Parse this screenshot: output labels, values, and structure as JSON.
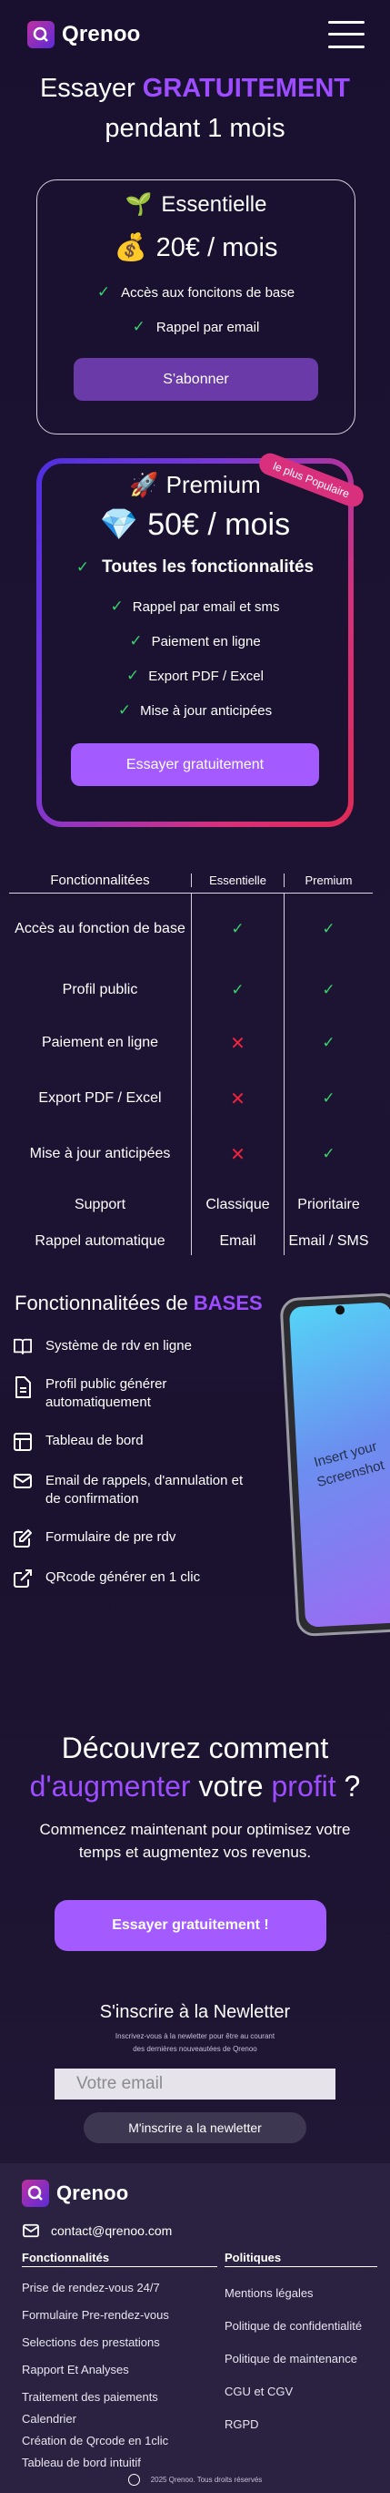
{
  "header": {
    "brand": "Qrenoo",
    "menu_icon": "hamburger-menu-icon"
  },
  "hero": {
    "line1_plain": "Essayer ",
    "line1_accent": "GRATUITEMENT",
    "line2": "pendant 1 mois"
  },
  "plan_basic": {
    "emoji": "🌱",
    "name": "Essentielle",
    "price_emoji": "💰",
    "price": "20€ / mois",
    "features": [
      "Accès aux foncitons de base",
      "Rappel par email"
    ],
    "button": "S'abonner"
  },
  "plan_premium": {
    "ribbon": "le plus Populaire",
    "emoji": "🚀",
    "name": "Premium",
    "price_emoji": "💎",
    "price": "50€ / mois",
    "headline": "Toutes les fonctionnalités",
    "features": [
      "Rappel par email et sms",
      "Paiement en ligne",
      "Export PDF / Excel",
      "Mise à jour anticipées"
    ],
    "button": "Essayer gratuitement"
  },
  "comparison": {
    "headers": [
      "Fonctionnalitées",
      "Essentielle",
      "Premium"
    ],
    "rows": [
      {
        "feature": "Accès au fonction de base",
        "essentielle": "✓",
        "premium": "✓"
      },
      {
        "feature": "Profil public",
        "essentielle": "✓",
        "premium": "✓"
      },
      {
        "feature": "Paiement en ligne",
        "essentielle": "✕",
        "premium": "✓"
      },
      {
        "feature": "Export PDF / Excel",
        "essentielle": "✕",
        "premium": "✓"
      },
      {
        "feature": "Mise à jour anticipées",
        "essentielle": "✕",
        "premium": "✓"
      },
      {
        "feature": "Support",
        "essentielle": "Classique",
        "premium": "Prioritaire"
      },
      {
        "feature": "Rappel automatique",
        "essentielle": "Email",
        "premium": "Email / SMS"
      }
    ]
  },
  "bases": {
    "title_plain": "Fonctionnalitées de ",
    "title_accent": "BASES",
    "items": [
      {
        "icon": "book-icon",
        "label": "Système de rdv en ligne"
      },
      {
        "icon": "document-icon",
        "label": "Profil public générer automatiquement"
      },
      {
        "icon": "dashboard-icon",
        "label": "Tableau de bord"
      },
      {
        "icon": "mail-icon",
        "label": "Email de rappels, d'annulation et de confirmation"
      },
      {
        "icon": "edit-icon",
        "label": "Formulaire de pre rdv"
      },
      {
        "icon": "external-link-icon",
        "label": "QRcode générer en 1 clic"
      }
    ],
    "phone_text": "Insert your Screenshot"
  },
  "discover": {
    "line1": "Découvrez comment",
    "accent1": "d'augmenter",
    "middle": " votre ",
    "accent2": "profit",
    "end": " ?",
    "text": "Commencez maintenant pour optimisez votre temps et augmentez vos revenus.",
    "button": "Essayer gratuitement !"
  },
  "newsletter": {
    "title": "S'inscrire à la Newletter",
    "sub": "Inscrivez-vous à la newletter pour être au courant des dernières nouveautées de Qrenoo",
    "placeholder": "Votre email",
    "button": "M'inscrire a la newletter"
  },
  "footer": {
    "brand": "Qrenoo",
    "email": "contact@qrenoo.com",
    "col1_title": "Fonctionnalités",
    "col1_links": [
      "Prise de rendez-vous 24/7",
      "Formulaire Pre-rendez-vous",
      "Selections des prestations",
      "Rapport Et Analyses",
      "Traitement des paiements",
      "Calendrier",
      "Création de Qrcode en 1clic",
      "Tableau de bord intuitif"
    ],
    "col2_title": "Politiques",
    "col2_links": [
      "Mentions légales",
      "Politique de confidentialité",
      "Politique de maintenance",
      "CGU et CGV",
      "RGPD"
    ],
    "copyright": "2025 Qrenoo. Tous droits réservés"
  },
  "colors": {
    "accent": "#9d4dff",
    "check": "#3ad06a",
    "cross": "#f0243a",
    "background": "#1b1230"
  }
}
